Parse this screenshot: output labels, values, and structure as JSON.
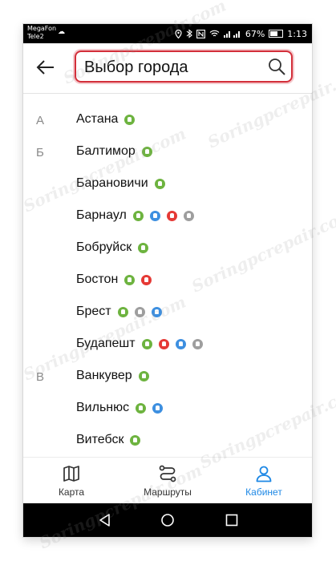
{
  "status_bar": {
    "carrier_1": "MegaFon",
    "carrier_2": "Tele2",
    "battery_percent": "67%",
    "time": "1:13",
    "icons": [
      "cloud-icon",
      "location-icon",
      "bluetooth-icon",
      "nfc-icon",
      "wifi-icon",
      "signal-icon",
      "battery-icon"
    ]
  },
  "header": {
    "back_icon": "arrow-left-icon",
    "search_text": "Выбор города",
    "search_icon": "search-icon"
  },
  "cities": [
    {
      "letter": "А",
      "name": "Астана",
      "badges": [
        "green"
      ]
    },
    {
      "letter": "Б",
      "name": "Балтимор",
      "badges": [
        "green"
      ]
    },
    {
      "letter": "",
      "name": "Барановичи",
      "badges": [
        "green"
      ]
    },
    {
      "letter": "",
      "name": "Барнаул",
      "badges": [
        "green",
        "blue",
        "red",
        "gray"
      ]
    },
    {
      "letter": "",
      "name": "Бобруйск",
      "badges": [
        "green"
      ]
    },
    {
      "letter": "",
      "name": "Бостон",
      "badges": [
        "green",
        "red"
      ]
    },
    {
      "letter": "",
      "name": "Брест",
      "badges": [
        "green",
        "gray",
        "blue"
      ]
    },
    {
      "letter": "",
      "name": "Будапешт",
      "badges": [
        "green",
        "red",
        "blue",
        "gray"
      ]
    },
    {
      "letter": "В",
      "name": "Ванкувер",
      "badges": [
        "green"
      ]
    },
    {
      "letter": "",
      "name": "Вильнюс",
      "badges": [
        "green",
        "blue"
      ]
    },
    {
      "letter": "",
      "name": "Витебск",
      "badges": [
        "green"
      ]
    }
  ],
  "badge_colors": {
    "green": "#6db33f",
    "blue": "#3d8fe0",
    "red": "#e53935",
    "gray": "#9e9e9e"
  },
  "bottom_nav": {
    "items": [
      {
        "label": "Карта",
        "icon": "map-icon",
        "active": false
      },
      {
        "label": "Маршруты",
        "icon": "route-icon",
        "active": false
      },
      {
        "label": "Кабинет",
        "icon": "user-icon",
        "active": true
      }
    ],
    "accent_color": "#1e88e5"
  },
  "system_nav": {
    "icons": [
      "back-triangle-icon",
      "home-circle-icon",
      "recents-square-icon"
    ]
  },
  "watermark": "Soringpcrepair.com"
}
